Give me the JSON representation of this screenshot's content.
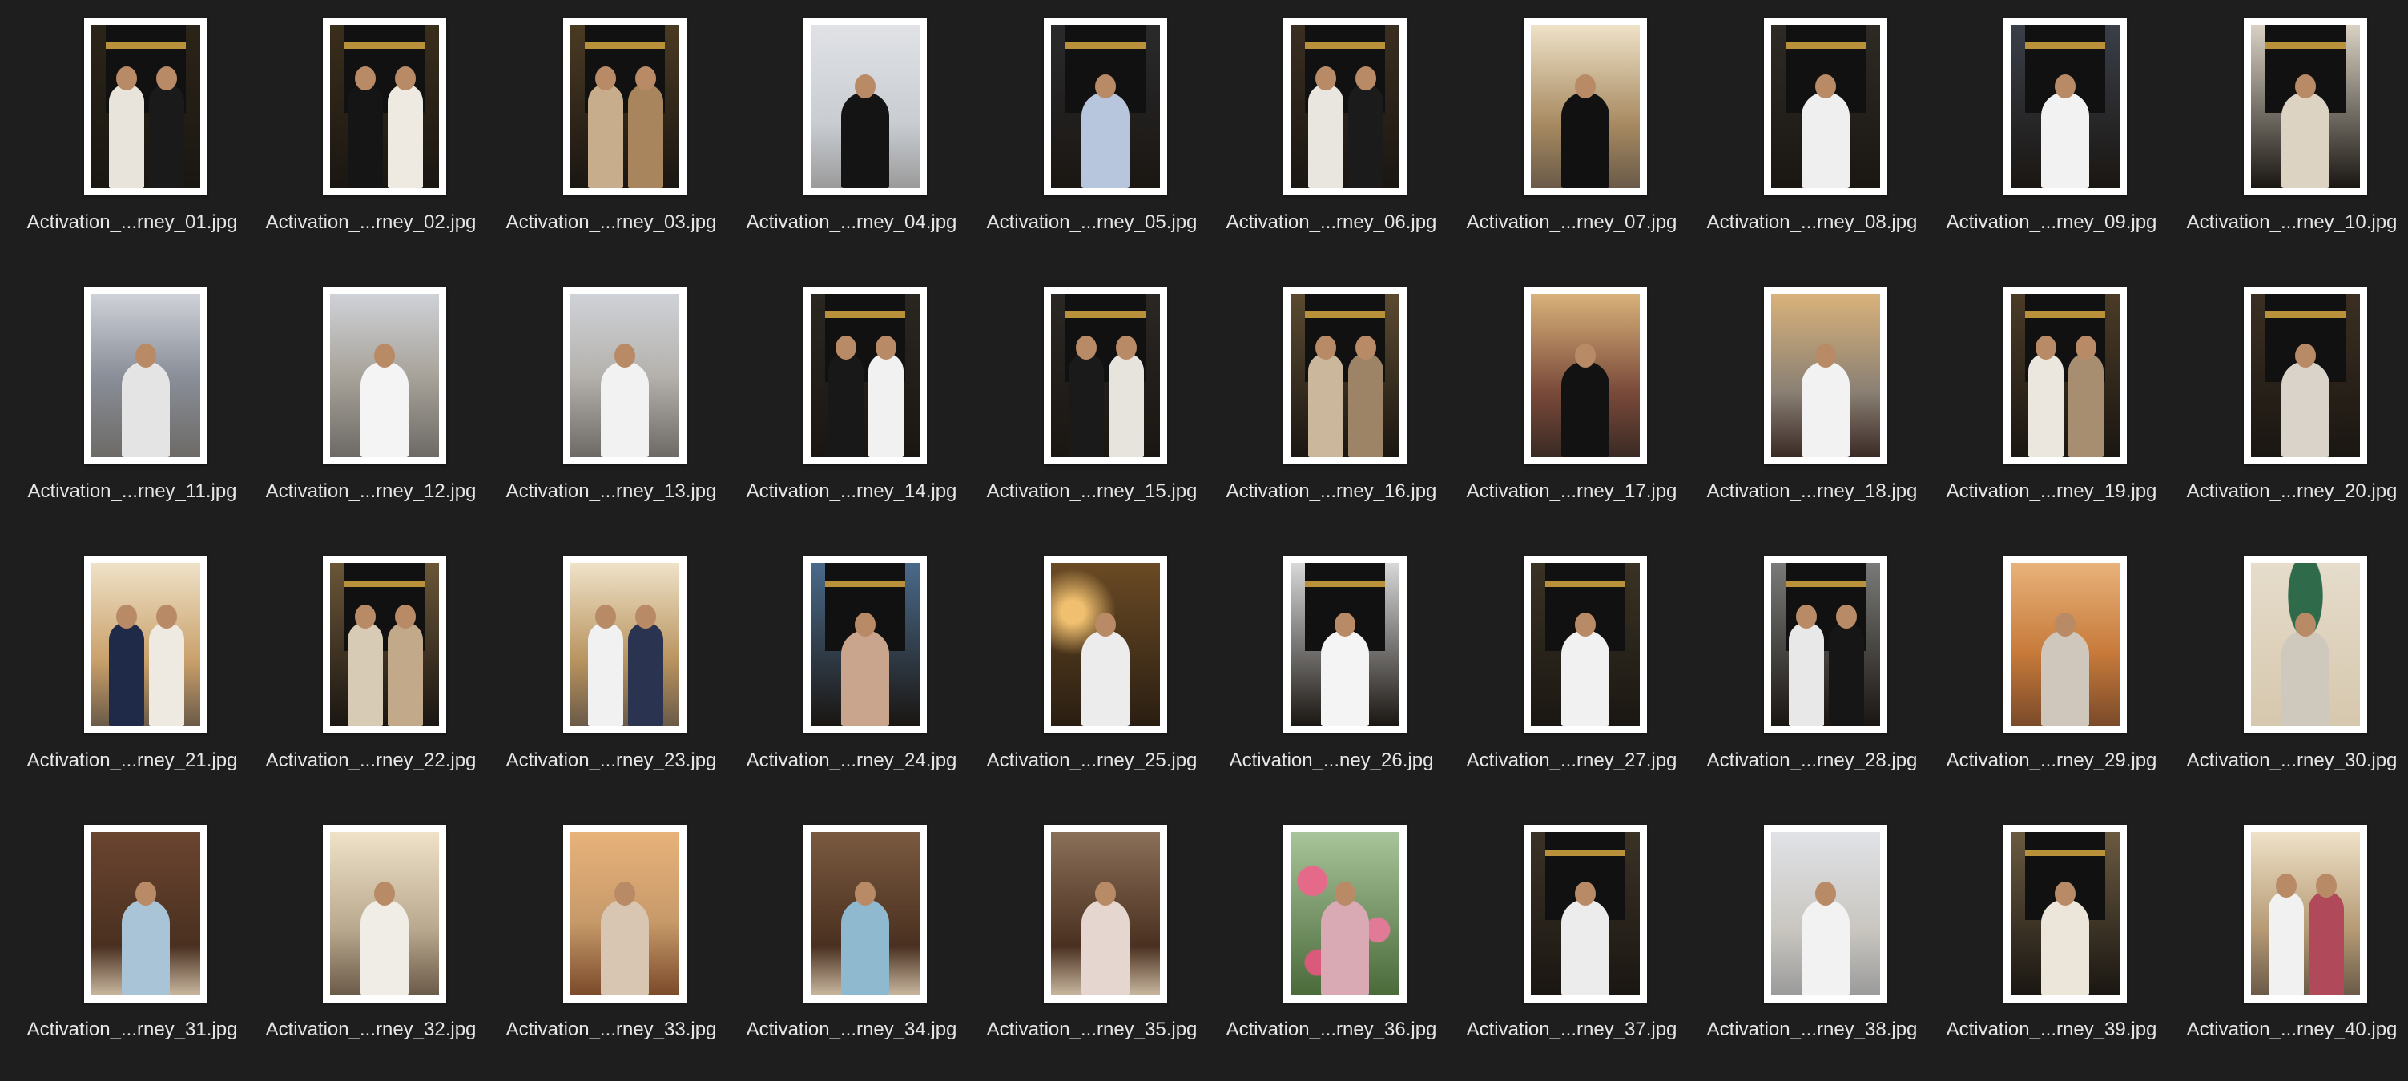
{
  "files": [
    {
      "name": "Activation_...rney_01.jpg",
      "scene": "kaaba",
      "tint": "#2b2418",
      "fg": "#e8e4dc",
      "fg2": "#1a1a1a"
    },
    {
      "name": "Activation_...rney_02.jpg",
      "scene": "kaaba",
      "tint": "#3a2e1c",
      "fg": "#151515",
      "fg2": "#eeeae2"
    },
    {
      "name": "Activation_...rney_03.jpg",
      "scene": "kaaba",
      "tint": "#4a3a22",
      "fg": "#c7ad8c",
      "fg2": "#a8855c"
    },
    {
      "name": "Activation_...rney_04.jpg",
      "scene": "mosque",
      "tint": "#c9cdd2",
      "fg": "#141414",
      "fg2": "#141414"
    },
    {
      "name": "Activation_...rney_05.jpg",
      "scene": "kaaba",
      "tint": "#2a2a2c",
      "fg": "#b7c6dc",
      "fg2": "#b7c6dc"
    },
    {
      "name": "Activation_...rney_06.jpg",
      "scene": "kaaba",
      "tint": "#3a2e20",
      "fg": "#e9e6df",
      "fg2": "#1b1b1b"
    },
    {
      "name": "Activation_...rney_07.jpg",
      "scene": "arch",
      "tint": "#a88b62",
      "fg": "#111111",
      "fg2": "#111111"
    },
    {
      "name": "Activation_...rney_08.jpg",
      "scene": "kaaba",
      "tint": "#2e2a24",
      "fg": "#efefef",
      "fg2": "#efefef"
    },
    {
      "name": "Activation_...rney_09.jpg",
      "scene": "kaaba",
      "tint": "#3a3f48",
      "fg": "#f2f2f2",
      "fg2": "#f2f2f2"
    },
    {
      "name": "Activation_...rney_10.jpg",
      "scene": "kaaba",
      "tint": "#d9d2c4",
      "fg": "#ddd3c2",
      "fg2": "#ddd3c2"
    },
    {
      "name": "Activation_...rney_11.jpg",
      "scene": "crowd",
      "tint": "#8a8f99",
      "fg": "#e4e4e4",
      "fg2": "#e4e4e4"
    },
    {
      "name": "Activation_...rney_12.jpg",
      "scene": "crowd",
      "tint": "#a8a39a",
      "fg": "#f4f4f4",
      "fg2": "#f4f4f4"
    },
    {
      "name": "Activation_...rney_13.jpg",
      "scene": "crowd",
      "tint": "#b5b2ad",
      "fg": "#f2f2f2",
      "fg2": "#f2f2f2"
    },
    {
      "name": "Activation_...rney_14.jpg",
      "scene": "kaaba",
      "tint": "#2a2620",
      "fg": "#181818",
      "fg2": "#f1f1f1"
    },
    {
      "name": "Activation_...rney_15.jpg",
      "scene": "kaaba",
      "tint": "#2a2724",
      "fg": "#1a1a1a",
      "fg2": "#e7e4de"
    },
    {
      "name": "Activation_...rney_16.jpg",
      "scene": "kaaba",
      "tint": "#5b4a30",
      "fg": "#cbb79b",
      "fg2": "#9e8466"
    },
    {
      "name": "Activation_...rney_17.jpg",
      "scene": "market",
      "tint": "#7a4a3a",
      "fg": "#121212",
      "fg2": "#121212"
    },
    {
      "name": "Activation_...rney_18.jpg",
      "scene": "market",
      "tint": "#8a8074",
      "fg": "#f2f2f2",
      "fg2": "#f2f2f2"
    },
    {
      "name": "Activation_...rney_19.jpg",
      "scene": "kaaba",
      "tint": "#4a3b26",
      "fg": "#ece7de",
      "fg2": "#a78e70"
    },
    {
      "name": "Activation_...rney_20.jpg",
      "scene": "kaaba",
      "tint": "#3b2f22",
      "fg": "#d9d3ca",
      "fg2": "#d9d3ca"
    },
    {
      "name": "Activation_...rney_21.jpg",
      "scene": "arch",
      "tint": "#c9a06a",
      "fg": "#1f2a48",
      "fg2": "#eeeae2"
    },
    {
      "name": "Activation_...rney_22.jpg",
      "scene": "kaaba",
      "tint": "#6a5638",
      "fg": "#d8cbb6",
      "fg2": "#c2a98a"
    },
    {
      "name": "Activation_...rney_23.jpg",
      "scene": "arch",
      "tint": "#b8935e",
      "fg": "#f1f1f1",
      "fg2": "#2a3350"
    },
    {
      "name": "Activation_...rney_24.jpg",
      "scene": "kaaba",
      "tint": "#4a6a8a",
      "fg": "#c9a58e",
      "fg2": "#c9a58e"
    },
    {
      "name": "Activation_...rney_25.jpg",
      "scene": "warm",
      "tint": "#6a4a24",
      "fg": "#ececec",
      "fg2": "#ececec"
    },
    {
      "name": "Activation_...ney_26.jpg",
      "scene": "kaaba",
      "tint": "#d8d8d8",
      "fg": "#f4f4f4",
      "fg2": "#f4f4f4"
    },
    {
      "name": "Activation_...rney_27.jpg",
      "scene": "kaaba",
      "tint": "#3a3324",
      "fg": "#f1f1f1",
      "fg2": "#f1f1f1"
    },
    {
      "name": "Activation_...rney_28.jpg",
      "scene": "kaaba",
      "tint": "#7a7a78",
      "fg": "#e8e8e8",
      "fg2": "#161616"
    },
    {
      "name": "Activation_...rney_29.jpg",
      "scene": "sunset",
      "tint": "#c77a3a",
      "fg": "#cfc6bc",
      "fg2": "#cfc6bc"
    },
    {
      "name": "Activation_...rney_30.jpg",
      "scene": "dome",
      "tint": "#d6c8ae",
      "fg": "#cfc8bd",
      "fg2": "#cfc8bd"
    },
    {
      "name": "Activation_...rney_31.jpg",
      "scene": "door",
      "tint": "#6a4530",
      "fg": "#a9c4d6",
      "fg2": "#a9c4d6"
    },
    {
      "name": "Activation_...rney_32.jpg",
      "scene": "arch",
      "tint": "#b8a88e",
      "fg": "#f0ede6",
      "fg2": "#f0ede6"
    },
    {
      "name": "Activation_...rney_33.jpg",
      "scene": "sunset",
      "tint": "#c79a6a",
      "fg": "#d8c6b2",
      "fg2": "#d8c6b2"
    },
    {
      "name": "Activation_...rney_34.jpg",
      "scene": "door",
      "tint": "#7a5a40",
      "fg": "#8fb9cf",
      "fg2": "#8fb9cf"
    },
    {
      "name": "Activation_...rney_35.jpg",
      "scene": "door",
      "tint": "#8a7058",
      "fg": "#e6d6d0",
      "fg2": "#e6d6d0"
    },
    {
      "name": "Activation_...rney_36.jpg",
      "scene": "garden",
      "tint": "#4a6a3a",
      "fg": "#d9a9b4",
      "fg2": "#d9a9b4"
    },
    {
      "name": "Activation_...rney_37.jpg",
      "scene": "kaaba",
      "tint": "#3a3226",
      "fg": "#ececec",
      "fg2": "#ececec"
    },
    {
      "name": "Activation_...rney_38.jpg",
      "scene": "mosque",
      "tint": "#c9c6c0",
      "fg": "#f2f2f2",
      "fg2": "#f2f2f2"
    },
    {
      "name": "Activation_...rney_39.jpg",
      "scene": "kaaba",
      "tint": "#6a5a40",
      "fg": "#ece6da",
      "fg2": "#ece6da"
    },
    {
      "name": "Activation_...rney_40.jpg",
      "scene": "arch",
      "tint": "#b59a74",
      "fg": "#f1f1f1",
      "fg2": "#b04a5a"
    }
  ]
}
